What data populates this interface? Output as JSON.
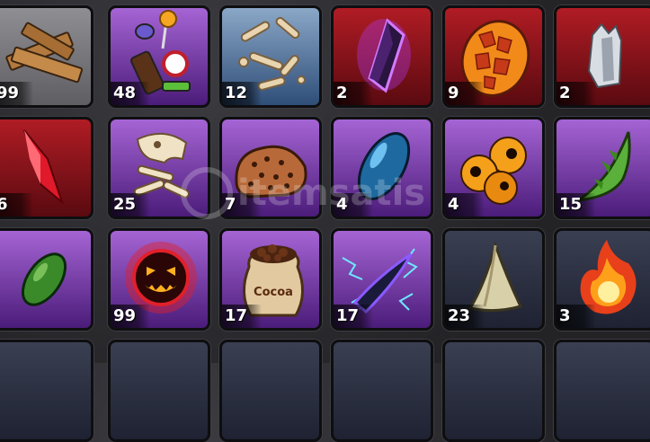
{
  "inventory": {
    "items": [
      {
        "icon": "wooden-planks-icon",
        "count": "99",
        "rarity": "gray"
      },
      {
        "icon": "candy-pile-icon",
        "count": "48",
        "rarity": "purple"
      },
      {
        "icon": "bones-icon",
        "count": "12",
        "rarity": "blue"
      },
      {
        "icon": "dark-crystal-icon",
        "count": "2",
        "rarity": "red"
      },
      {
        "icon": "lava-egg-icon",
        "count": "9",
        "rarity": "red"
      },
      {
        "icon": "silver-shard-icon",
        "count": "2",
        "rarity": "red"
      },
      {
        "icon": "red-crystal-icon",
        "count": "6",
        "rarity": "red"
      },
      {
        "icon": "dinosaur-fossil-icon",
        "count": "25",
        "rarity": "purple"
      },
      {
        "icon": "cookie-rock-icon",
        "count": "7",
        "rarity": "purple"
      },
      {
        "icon": "blue-seed-icon",
        "count": "4",
        "rarity": "purple"
      },
      {
        "icon": "orange-eyeballs-icon",
        "count": "4",
        "rarity": "purple"
      },
      {
        "icon": "green-spiky-horn-icon",
        "count": "15",
        "rarity": "purple"
      },
      {
        "icon": "green-seed-icon",
        "count": "",
        "rarity": "purple"
      },
      {
        "icon": "jack-o-lantern-orb-icon",
        "count": "99",
        "rarity": "purple"
      },
      {
        "icon": "cocoa-sack-icon",
        "count": "17",
        "rarity": "purple"
      },
      {
        "icon": "lightning-blade-icon",
        "count": "17",
        "rarity": "purple"
      },
      {
        "icon": "shark-tooth-icon",
        "count": "23",
        "rarity": "dark"
      },
      {
        "icon": "fireball-icon",
        "count": "3",
        "rarity": "dark"
      }
    ],
    "partial_row_rarity": [
      "dark",
      "dark",
      "dark",
      "dark",
      "dark",
      "dark"
    ]
  },
  "labels": {
    "cocoa_sack_text": "Cocoa",
    "watermark_text": "itemsatis"
  },
  "colors": {
    "gray": "#8e8e93",
    "purple": "#7b3bb0",
    "red": "#8c1119",
    "blue": "#5a7aa3",
    "dark": "#2a2f42",
    "count_text": "#ffffff"
  }
}
